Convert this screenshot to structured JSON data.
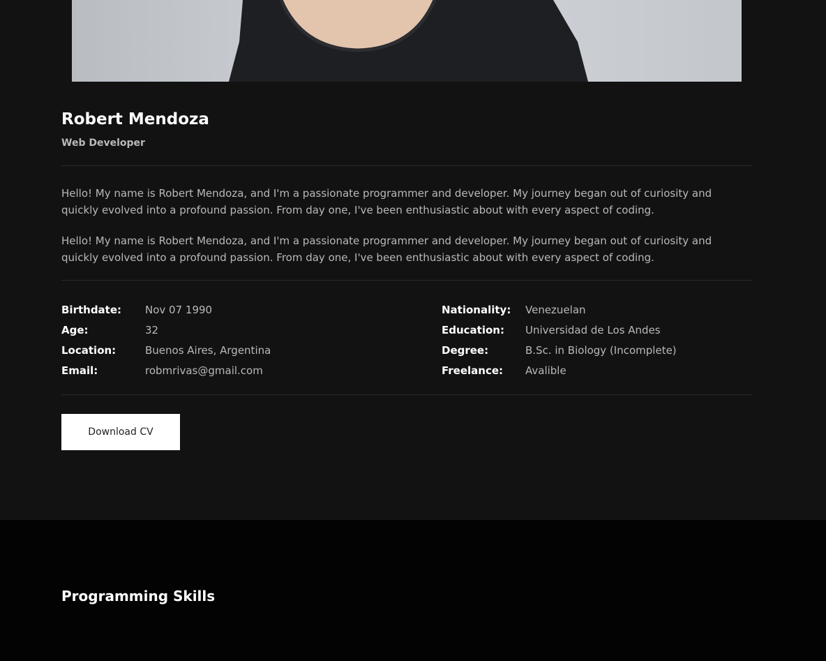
{
  "profile": {
    "name": "Robert Mendoza",
    "role": "Web Developer",
    "bio": [
      "Hello! My name is Robert Mendoza, and I'm a passionate programmer and developer. My journey began out of curiosity and quickly evolved into a profound passion. From day one, I've been enthusiastic about with every aspect of coding.",
      "Hello! My name is Robert Mendoza, and I'm a passionate programmer and developer. My journey began out of curiosity and quickly evolved into a profound passion. From day one, I've been enthusiastic about with every aspect of coding."
    ]
  },
  "info": {
    "left": [
      {
        "label": "Birthdate:",
        "value": "Nov 07 1990"
      },
      {
        "label": "Age:",
        "value": "32"
      },
      {
        "label": "Location:",
        "value": "Buenos Aires, Argentina"
      },
      {
        "label": "Email:",
        "value": "robmrivas@gmail.com"
      }
    ],
    "right": [
      {
        "label": "Nationality:",
        "value": "Venezuelan"
      },
      {
        "label": "Education:",
        "value": "Universidad de Los Andes"
      },
      {
        "label": "Degree:",
        "value": "B.Sc. in Biology (Incomplete)"
      },
      {
        "label": "Freelance:",
        "value": "Avalible"
      }
    ]
  },
  "actions": {
    "download_cv_label": "Download CV"
  },
  "skills": {
    "title": "Programming Skills"
  },
  "colors": {
    "background": "#121212",
    "skills_background": "#030303",
    "heading": "#ffffff",
    "body_text": "#b9b9b9",
    "button_background": "#ffffff"
  }
}
